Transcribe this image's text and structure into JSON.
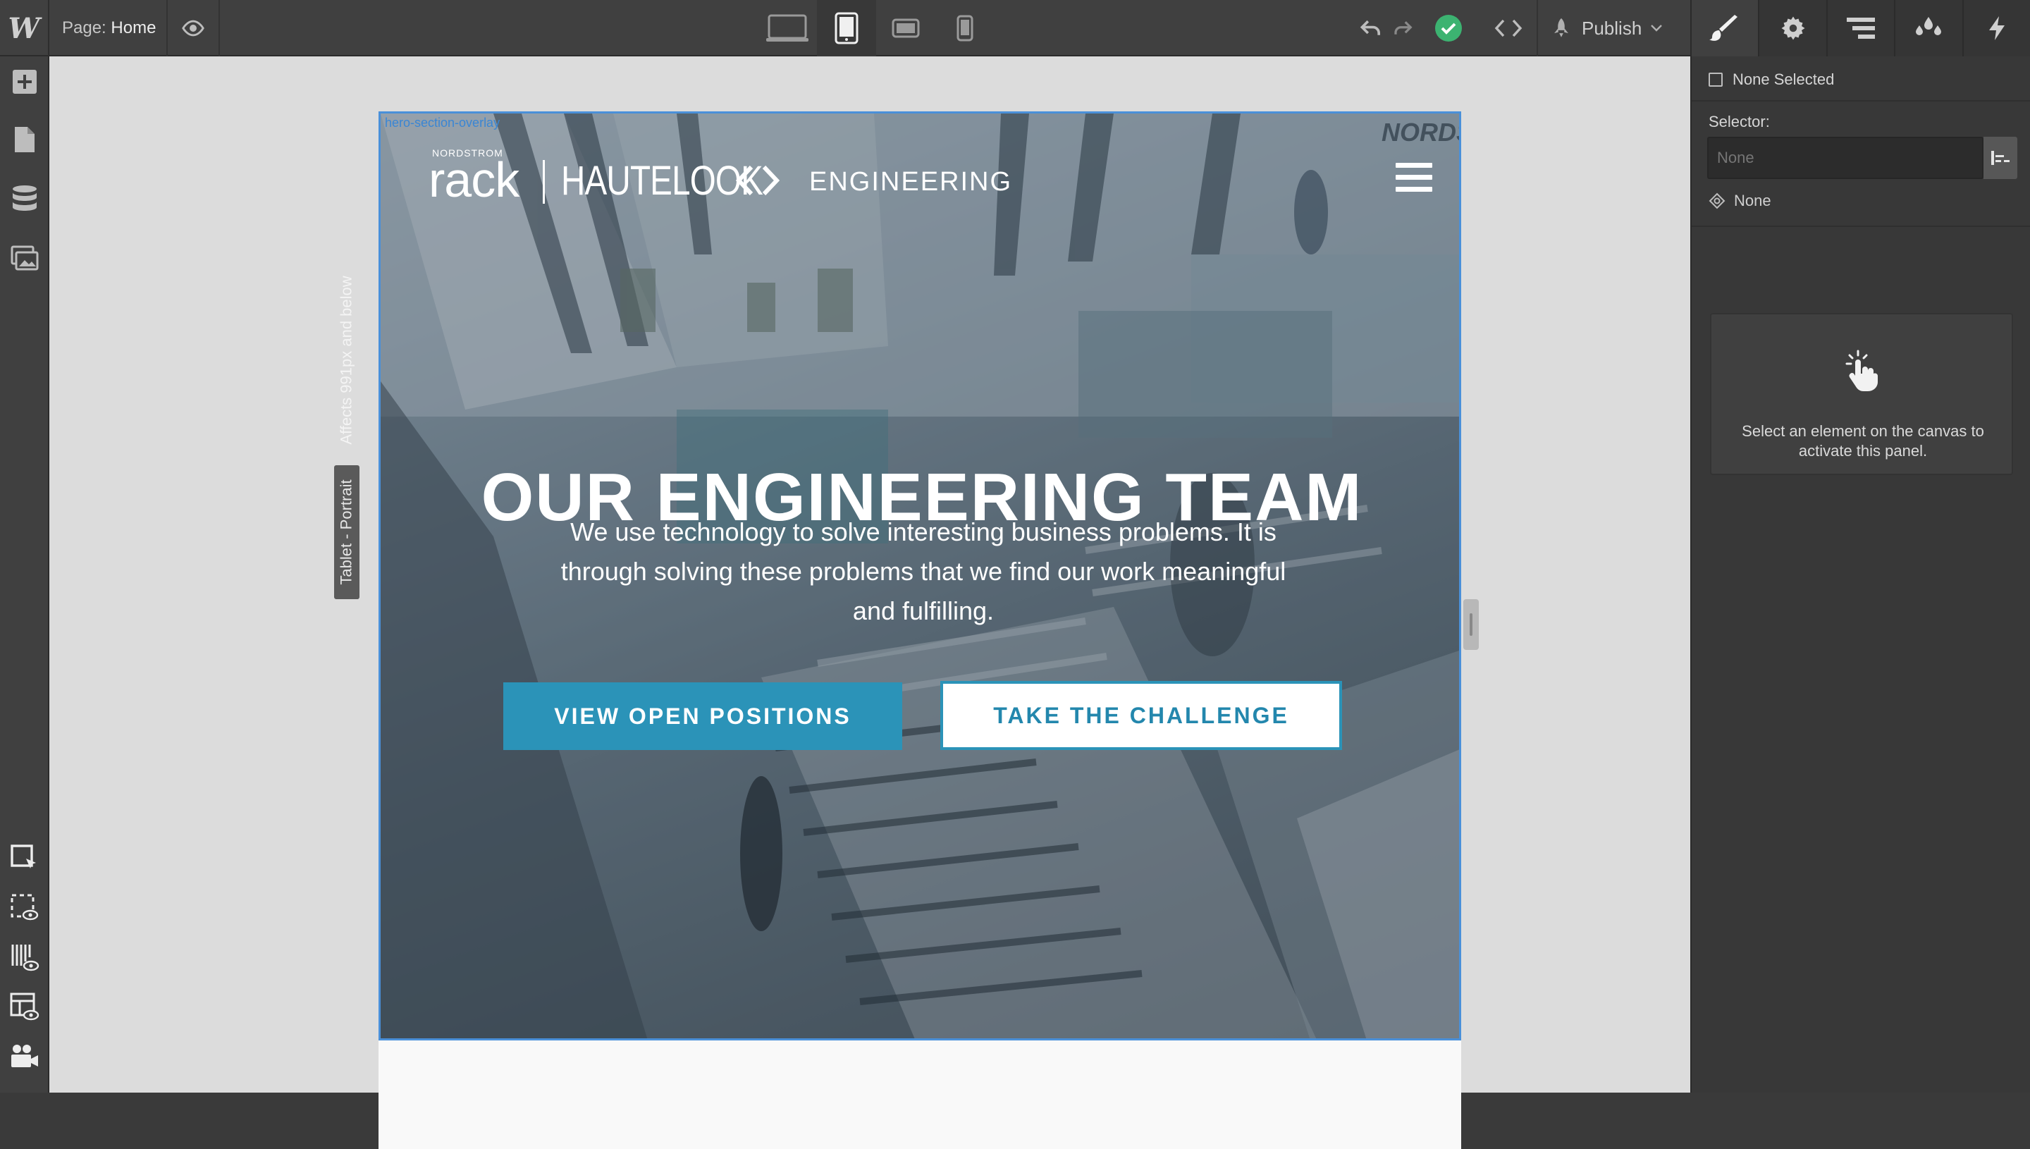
{
  "app": {
    "logo": "W",
    "page_label": "Page:",
    "page_name": "Home",
    "publish_label": "Publish"
  },
  "canvas": {
    "breakpoint_label": "Tablet - Portrait",
    "breakpoint_affects": "Affects 991px and below",
    "selected_class_label": "hero-section-overlay"
  },
  "site": {
    "nav": {
      "brand_small": "NORDSTROM",
      "brand_rack": "rack",
      "brand_hautelook": "HAUTELOOK",
      "brand_engineering": "ENGINEERING",
      "corner_text": "NORDS"
    },
    "hero": {
      "headline": "OUR ENGINEERING TEAM",
      "subtext": "We use technology to solve interesting business problems. It is through solving these problems that we find our work meaningful and fulfilling.",
      "primary_button": "VIEW OPEN POSITIONS",
      "secondary_button": "TAKE THE CHALLENGE"
    }
  },
  "right_panel": {
    "none_selected_label": "None Selected",
    "selector_label": "Selector:",
    "selector_placeholder": "None",
    "state_label": "None",
    "empty_message": "Select an element on the canvas to activate this panel."
  },
  "colors": {
    "accent_blue": "#2b93b8",
    "selection_blue": "#4a90d9",
    "status_green": "#3cb371"
  },
  "icons": {
    "left_toolbar": [
      "add-icon",
      "pages-icon",
      "cms-icon",
      "assets-icon",
      "select-outline-icon",
      "preview-dashed-icon",
      "xray-icon",
      "guides-icon",
      "video-icon"
    ],
    "devices": [
      "desktop-icon",
      "tablet-portrait-icon",
      "tablet-landscape-icon",
      "mobile-icon"
    ],
    "style_tabs": [
      "brush-icon",
      "gear-icon",
      "navigator-icon",
      "drops-icon",
      "bolt-icon"
    ]
  }
}
